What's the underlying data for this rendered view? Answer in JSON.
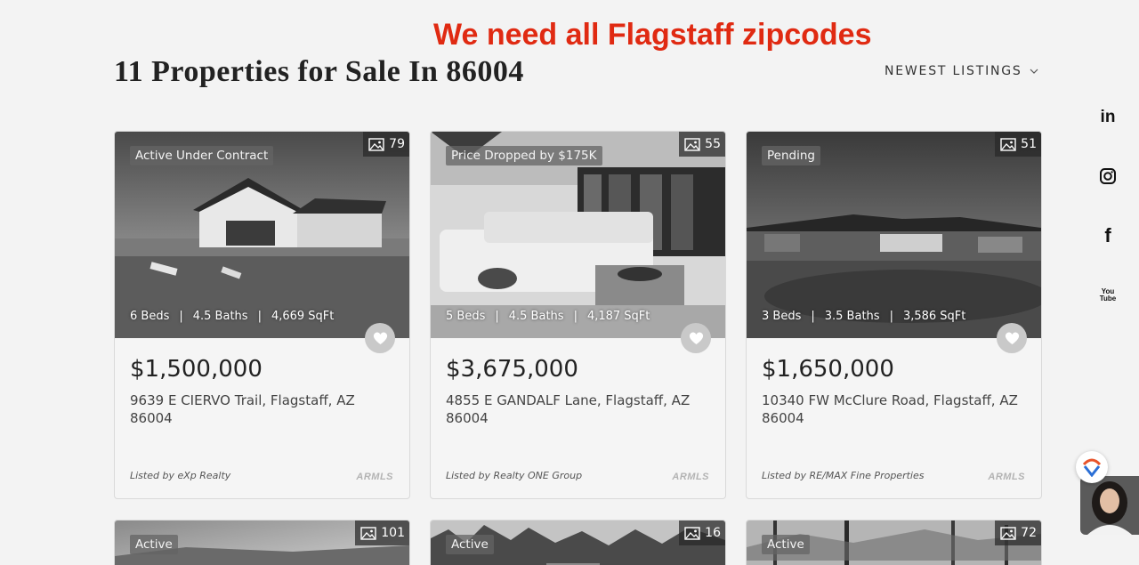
{
  "annotation": "We need all Flagstaff zipcodes",
  "page_title": "11 Properties for Sale In 86004",
  "sort": {
    "label": "NEWEST LISTINGS",
    "icon": "chevron-down-icon"
  },
  "social": [
    {
      "name": "linkedin-icon",
      "glyph": "in"
    },
    {
      "name": "instagram-icon",
      "glyph": ""
    },
    {
      "name": "facebook-icon",
      "glyph": "f"
    },
    {
      "name": "youtube-icon",
      "glyph": "You Tube"
    }
  ],
  "listings": [
    {
      "status": "Active Under Contract",
      "photo_count": "79",
      "beds": "6 Beds",
      "baths": "4.5 Baths",
      "sqft": "4,669 SqFt",
      "price": "$1,500,000",
      "address": "9639 E CIERVO Trail, Flagstaff, AZ 86004",
      "listed_by": "Listed by eXp Realty",
      "mls": "ARMLS"
    },
    {
      "status": "Price Dropped by $175K",
      "photo_count": "55",
      "beds": "5 Beds",
      "baths": "4.5 Baths",
      "sqft": "4,187 SqFt",
      "price": "$3,675,000",
      "address": "4855 E GANDALF Lane, Flagstaff, AZ 86004",
      "listed_by": "Listed by Realty ONE Group",
      "mls": "ARMLS"
    },
    {
      "status": "Pending",
      "photo_count": "51",
      "beds": "3 Beds",
      "baths": "3.5 Baths",
      "sqft": "3,586 SqFt",
      "price": "$1,650,000",
      "address": "10340 FW McClure Road, Flagstaff, AZ 86004",
      "listed_by": "Listed by RE/MAX Fine Properties",
      "mls": "ARMLS"
    },
    {
      "status": "Active",
      "photo_count": "101"
    },
    {
      "status": "Active",
      "photo_count": "16"
    },
    {
      "status": "Active",
      "photo_count": "72"
    }
  ],
  "colors": {
    "annotation": "#e02a12",
    "background": "#f3f3f3",
    "heart_bg": "#c9c9c9"
  }
}
